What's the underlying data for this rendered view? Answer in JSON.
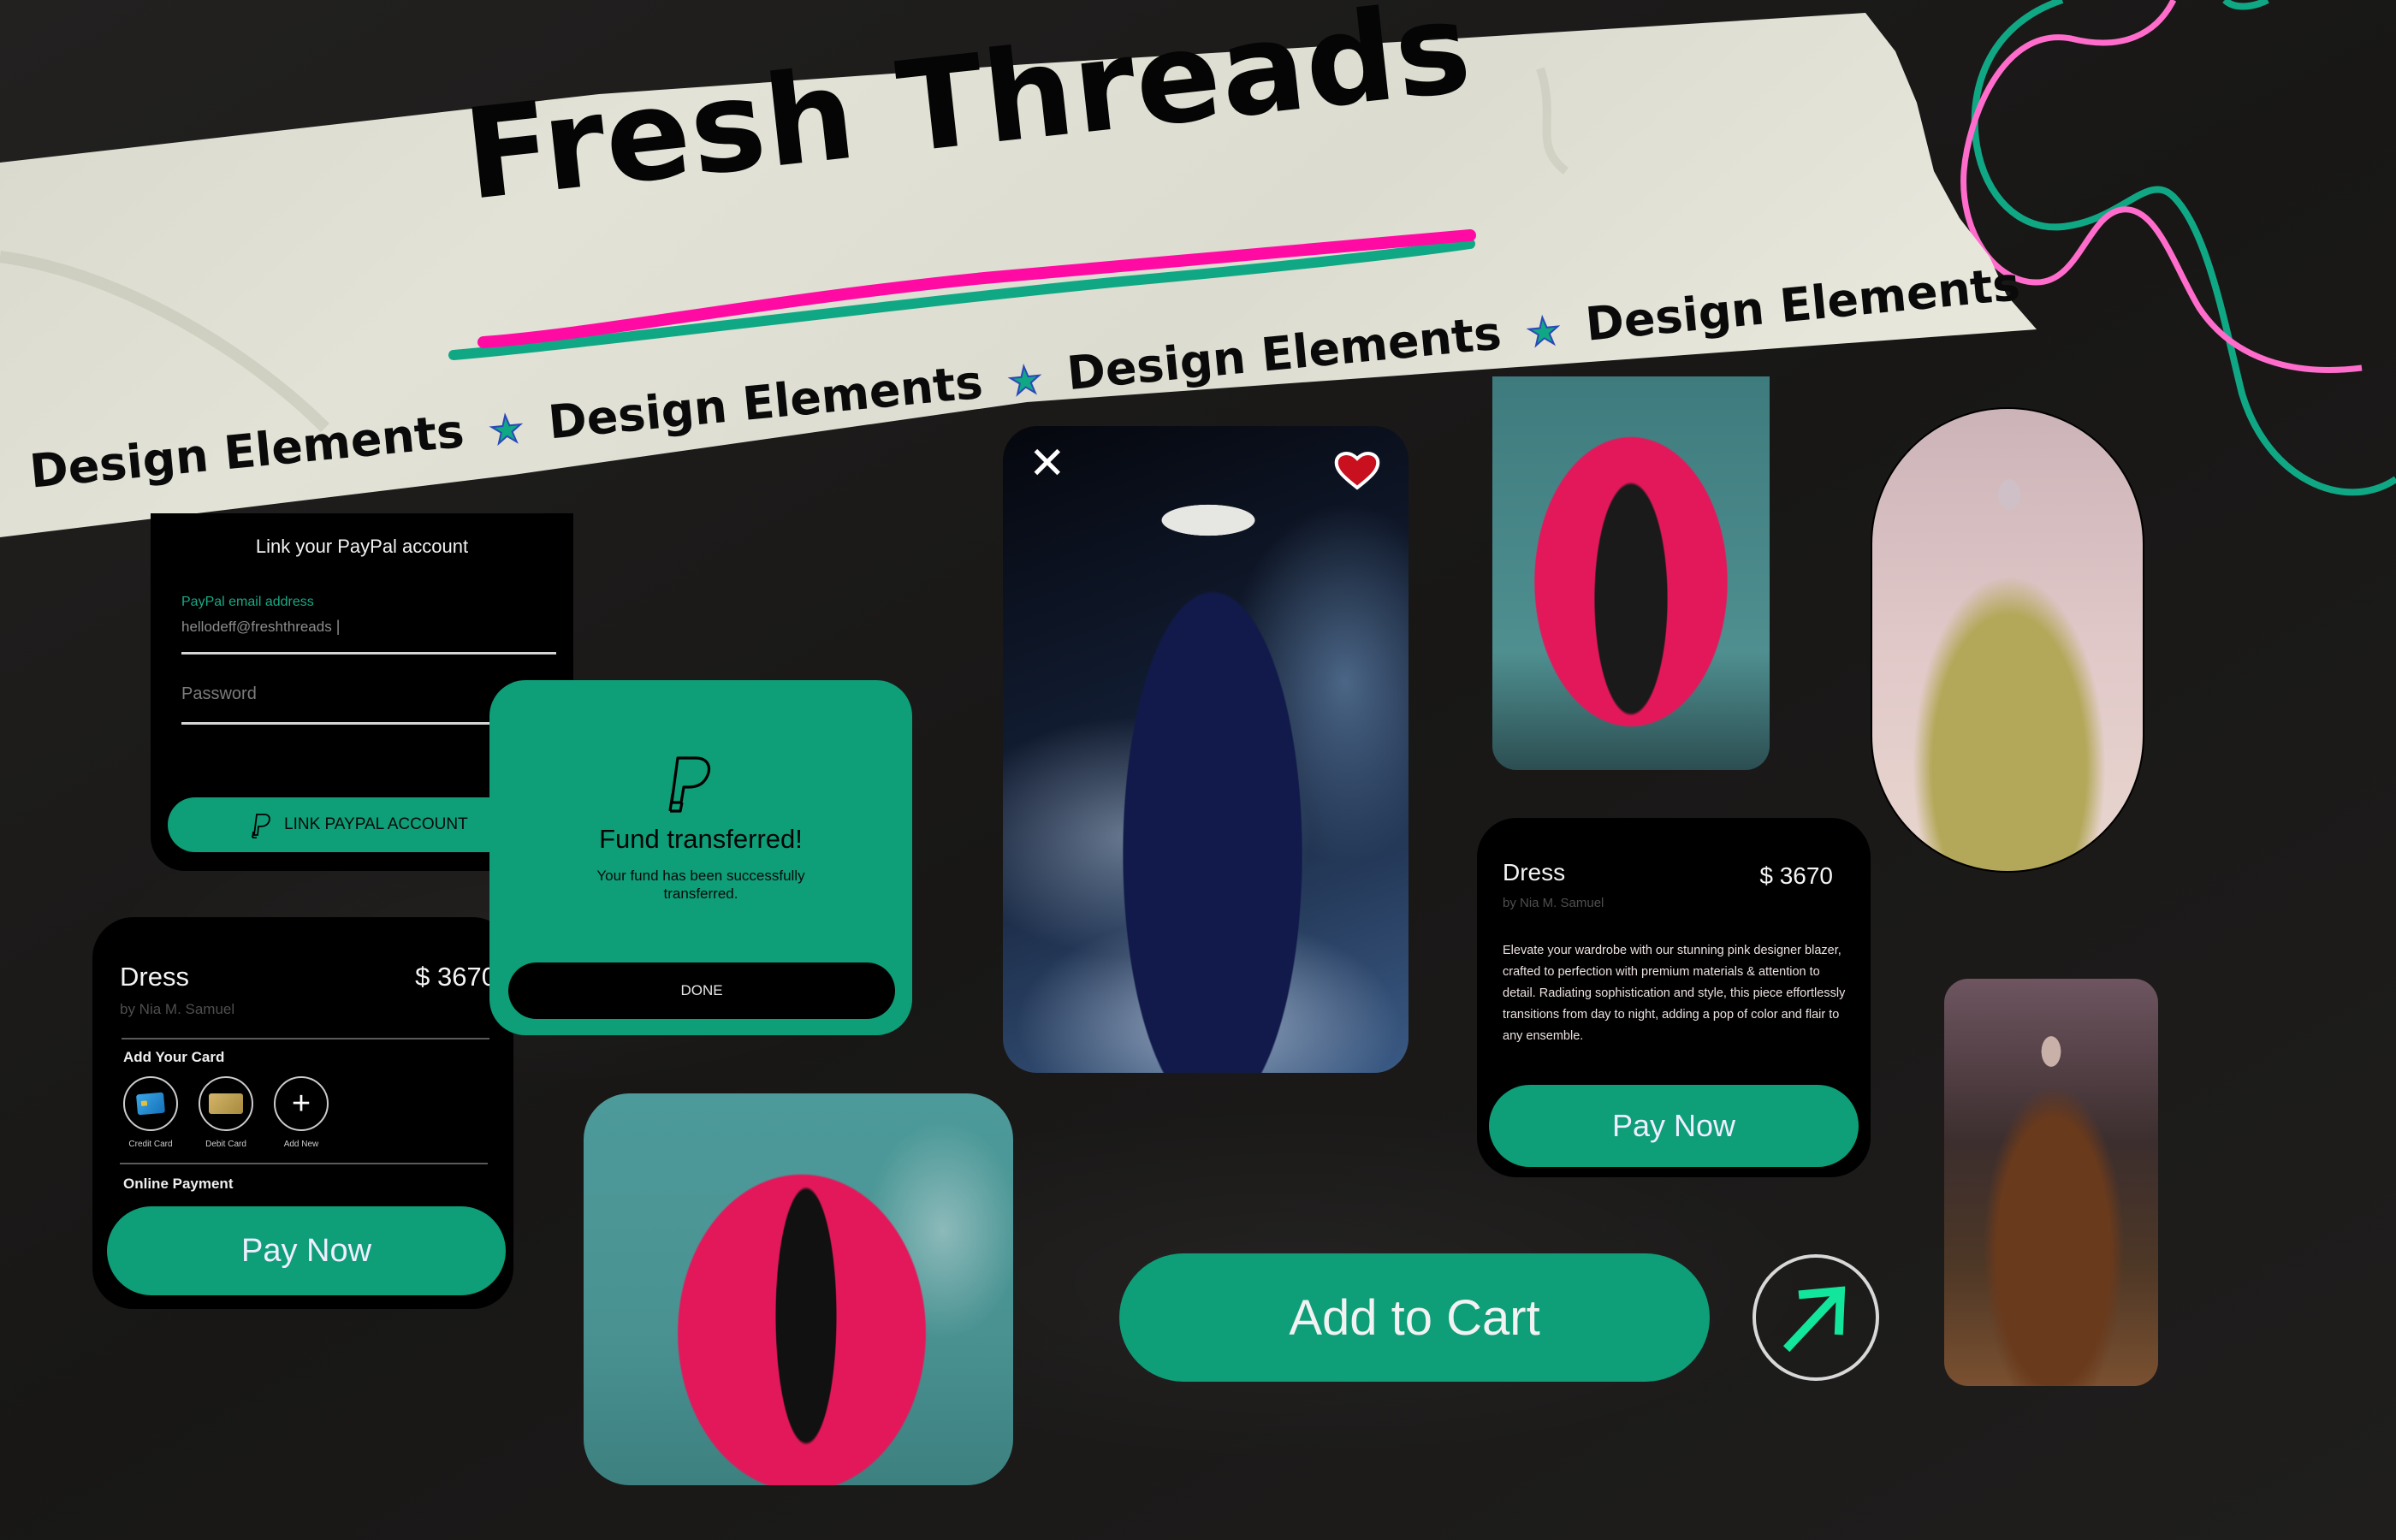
{
  "banner": {
    "title": "Fresh Threads",
    "strip_text": "Design Elements",
    "strip_repeats": [
      "Design Elements",
      "Design Elements",
      "Design Elements",
      "Design Elements"
    ],
    "underline_colors": {
      "pink": "#ff0ba3",
      "green": "#10a884"
    }
  },
  "colors": {
    "accent_green": "#0e9e78",
    "card_bg": "#000000",
    "page_bg": "#1b1a19",
    "heart_red": "#c8101e",
    "arrow_green": "#12e59c",
    "squiggle_pink": "#ff6ccb",
    "squiggle_green": "#10a884"
  },
  "paypal_link": {
    "heading": "Link your PayPal account",
    "email_label": "PayPal email address",
    "email_value": "hellodeff@freshthreads",
    "password_placeholder": "Password",
    "button_label": "LINK PAYPAL ACCOUNT",
    "button_icon": "paypal-icon"
  },
  "fund_dialog": {
    "icon": "paypal-icon",
    "title": "Fund transferred!",
    "message": "Your fund has been successfully transferred.",
    "button_label": "DONE"
  },
  "checkout_card": {
    "product": "Dress",
    "designer": "by Nia M. Samuel",
    "price": "$ 3670",
    "section_cards": "Add Your Card",
    "card_options": [
      {
        "label": "Credit Card",
        "icon": "credit-card-icon"
      },
      {
        "label": "Debit Card",
        "icon": "debit-card-icon"
      },
      {
        "label": "Add New",
        "icon": "plus-icon"
      }
    ],
    "section_online": "Online Payment",
    "button_label": "Pay Now"
  },
  "product_detail": {
    "product": "Dress",
    "designer": "by Nia M. Samuel",
    "price": "$ 3670",
    "description": "Elevate your wardrobe with our stunning pink designer blazer, crafted to perfection with premium materials & attention to detail. Radiating sophistication and style, this piece effortlessly transitions from day to night, adding a pop of color and flair to any ensemble.",
    "button_label": "Pay Now"
  },
  "hero_image": {
    "alt": "Navy blue midi dress on mannequin with pearl necklace in smoke",
    "close_icon": "close-icon",
    "favorite_icon": "heart-icon",
    "favorited": true
  },
  "images": [
    {
      "alt": "Pink leather blazer on mannequin (top)"
    },
    {
      "alt": "Olive tulle gown with sequined sleeve"
    },
    {
      "alt": "Pink leather blazer on mannequin (bottom)"
    },
    {
      "alt": "Bronze embellished ball gown"
    }
  ],
  "actions": {
    "add_to_cart": "Add to Cart",
    "arrow_icon": "arrow-up-right-icon"
  }
}
